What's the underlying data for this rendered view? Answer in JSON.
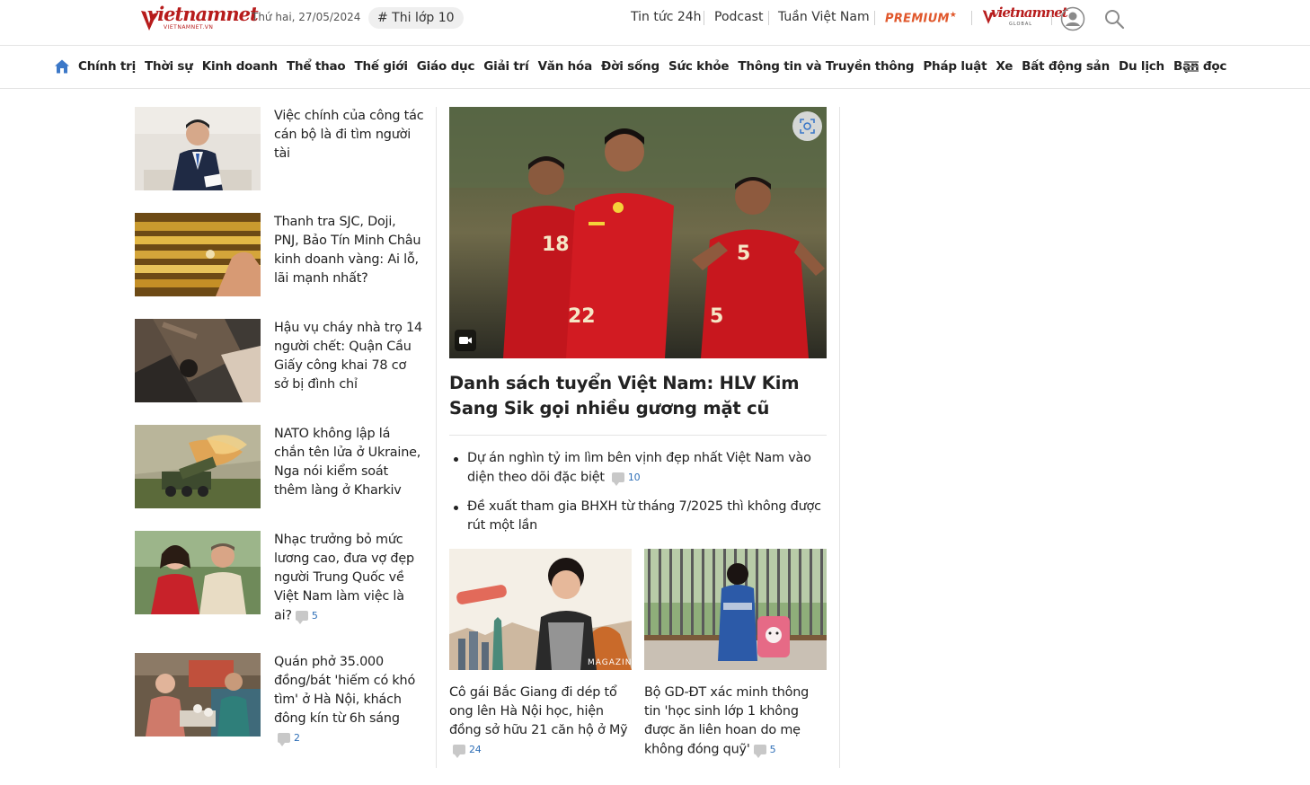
{
  "header": {
    "logo_text": "vietnamnet",
    "logo_sub": "VIETNAMNET.VN",
    "date": "Thứ hai, 27/05/2024",
    "hashtag": "# Thi lớp 10",
    "links": [
      "Tin tức 24h",
      "Podcast",
      "Tuần Việt Nam"
    ],
    "premium": "PREMIUM",
    "global_logo_text": "vietnamnet",
    "global_logo_sub": "GLOBAL"
  },
  "nav": {
    "items": [
      "Chính trị",
      "Thời sự",
      "Kinh doanh",
      "Thể thao",
      "Thế giới",
      "Giáo dục",
      "Giải trí",
      "Văn hóa",
      "Đời sống",
      "Sức khỏe",
      "Thông tin và Truyền thông",
      "Pháp luật",
      "Xe",
      "Bất động sản",
      "Du lịch",
      "Bạn đọc"
    ]
  },
  "left_articles": [
    {
      "title": "Việc chính của công tác cán bộ là đi tìm người tài",
      "comments": ""
    },
    {
      "title": "Thanh tra SJC, Doji, PNJ, Bảo Tín Minh Châu kinh doanh vàng: Ai lỗ, lãi mạnh nhất?",
      "comments": ""
    },
    {
      "title": "Hậu vụ cháy nhà trọ 14 người chết: Quận Cầu Giấy công khai 78 cơ sở bị đình chỉ",
      "comments": ""
    },
    {
      "title": "NATO không lập lá chắn tên lửa ở Ukraine, Nga nói kiểm soát thêm làng ở Kharkiv",
      "comments": ""
    },
    {
      "title": "Nhạc trưởng bỏ mức lương cao, đưa vợ đẹp người Trung Quốc về Việt Nam làm việc là ai?",
      "comments": "5"
    },
    {
      "title": "Quán phở 35.000 đồng/bát 'hiếm có khó tìm' ở Hà Nội, khách đông kín từ 6h sáng",
      "comments": "2"
    }
  ],
  "hero": {
    "title": "Danh sách tuyển Việt Nam: HLV Kim Sang Sik gọi nhiều gương mặt cũ",
    "jersey_numbers": [
      "18",
      "22",
      "5"
    ]
  },
  "bullets": [
    {
      "title": "Dự án nghìn tỷ im lìm bên vịnh đẹp nhất Việt Nam vào diện theo dõi đặc biệt",
      "comments": "10"
    },
    {
      "title": "Đề xuất tham gia BHXH từ tháng 7/2025 thì không được rút một lần",
      "comments": ""
    }
  ],
  "sub_cards": [
    {
      "title": "Cô gái Bắc Giang đi dép tổ ong lên Hà Nội học, hiện đồng sở hữu 21 căn hộ ở Mỹ",
      "comments": "24",
      "badge": "MAGAZINE"
    },
    {
      "title": "Bộ GD-ĐT xác minh thông tin 'học sinh lớp 1 không được ăn liên hoan do mẹ không đóng quỹ'",
      "comments": "5"
    }
  ],
  "colors": {
    "brand_red": "#b71c1c",
    "premium_orange": "#e0572b",
    "link_blue": "#2f6fb7"
  }
}
